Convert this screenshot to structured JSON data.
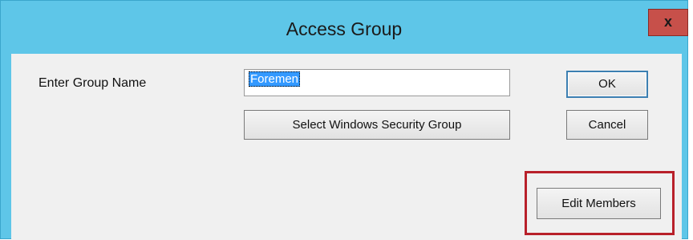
{
  "window": {
    "title": "Access Group",
    "close_label": "x"
  },
  "form": {
    "group_name_label": "Enter Group Name",
    "group_name_value": "Foremen"
  },
  "buttons": {
    "ok": "OK",
    "cancel": "Cancel",
    "select_windows_group": "Select Windows Security Group",
    "edit_members": "Edit Members"
  },
  "colors": {
    "titlebar": "#5ec6e8",
    "close_button": "#c7504a",
    "highlight_box": "#b8202a",
    "selection": "#3399ff"
  }
}
